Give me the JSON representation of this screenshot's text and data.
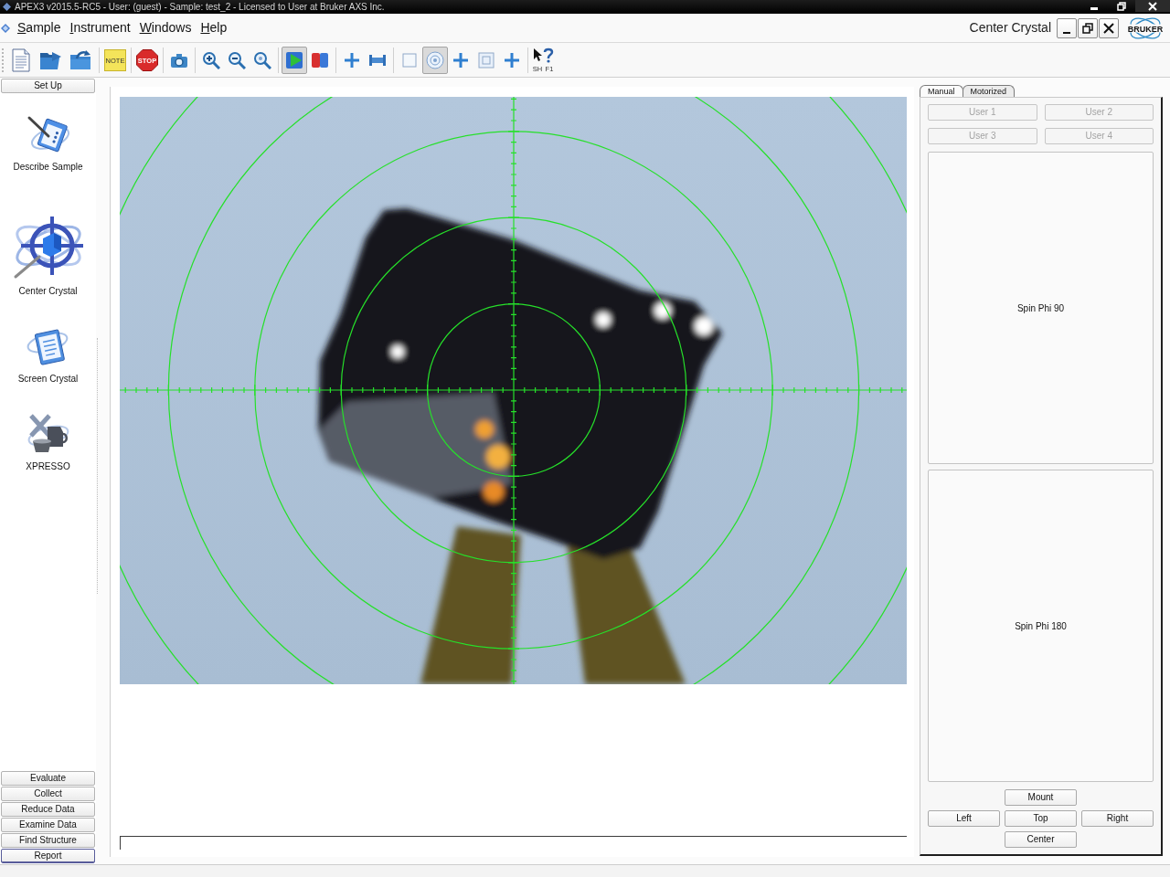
{
  "window": {
    "title": "APEX3 v2015.5-RC5 - User: (guest) - Sample: test_2 - Licensed to User at Bruker AXS Inc."
  },
  "menu": [
    "Sample",
    "Instrument",
    "Windows",
    "Help"
  ],
  "view_title": "Center Crystal",
  "logo": "BRUKER",
  "toolbar": [
    [
      {
        "kind": "document",
        "pressed": false
      },
      {
        "kind": "open_folder",
        "pressed": false
      },
      {
        "kind": "folder_arrow",
        "pressed": false
      }
    ],
    [
      {
        "kind": "note",
        "label": "NOTE",
        "pressed": false
      }
    ],
    [
      {
        "kind": "stop",
        "label": "STOP",
        "pressed": false
      }
    ],
    [
      {
        "kind": "camera",
        "pressed": false
      }
    ],
    [
      {
        "kind": "zoom_in",
        "pressed": false
      },
      {
        "kind": "zoom_out",
        "pressed": false
      },
      {
        "kind": "zoom_fit",
        "pressed": false
      }
    ],
    [
      {
        "kind": "play",
        "pressed": true
      },
      {
        "kind": "split",
        "pressed": false
      }
    ],
    [
      {
        "kind": "plus",
        "pressed": false
      },
      {
        "kind": "bar",
        "pressed": false
      }
    ],
    [
      {
        "kind": "square",
        "pressed": false
      },
      {
        "kind": "disc",
        "pressed": true
      },
      {
        "kind": "plus",
        "pressed": false
      },
      {
        "kind": "target",
        "pressed": false
      },
      {
        "kind": "plus",
        "pressed": false
      }
    ],
    [
      {
        "kind": "help",
        "labels": [
          "SH",
          "F1"
        ],
        "pressed": false
      }
    ]
  ],
  "sidebar": {
    "sections": [
      {
        "label": "Set Up",
        "focused": false,
        "items": [
          {
            "kind": "describe",
            "label": "Describe Sample",
            "selected": false
          },
          {
            "kind": "center",
            "label": "Center Crystal",
            "selected": true
          },
          {
            "kind": "screen",
            "label": "Screen Crystal",
            "selected": false
          },
          {
            "kind": "xpresso",
            "label": "XPRESSO",
            "selected": false
          }
        ]
      },
      {
        "label": "Evaluate",
        "focused": false
      },
      {
        "label": "Collect",
        "focused": false
      },
      {
        "label": "Reduce Data",
        "focused": false
      },
      {
        "label": "Examine Data",
        "focused": false
      },
      {
        "label": "Find Structure",
        "focused": false
      },
      {
        "label": "Report",
        "focused": true
      }
    ]
  },
  "right_panel": {
    "tabs": [
      {
        "label": "Manual",
        "selected": true
      },
      {
        "label": "Motorized",
        "selected": false
      }
    ],
    "user_buttons": [
      {
        "label": "User 1",
        "disabled": true
      },
      {
        "label": "User 2",
        "disabled": true
      },
      {
        "label": "User 3",
        "disabled": true
      },
      {
        "label": "User 4",
        "disabled": true
      }
    ],
    "spin_buttons": [
      "Spin Phi 90",
      "Spin Phi 180"
    ],
    "view_buttons": [
      [
        "Mount"
      ],
      [
        "Left",
        "Top",
        "Right"
      ],
      [
        "Center"
      ]
    ]
  }
}
